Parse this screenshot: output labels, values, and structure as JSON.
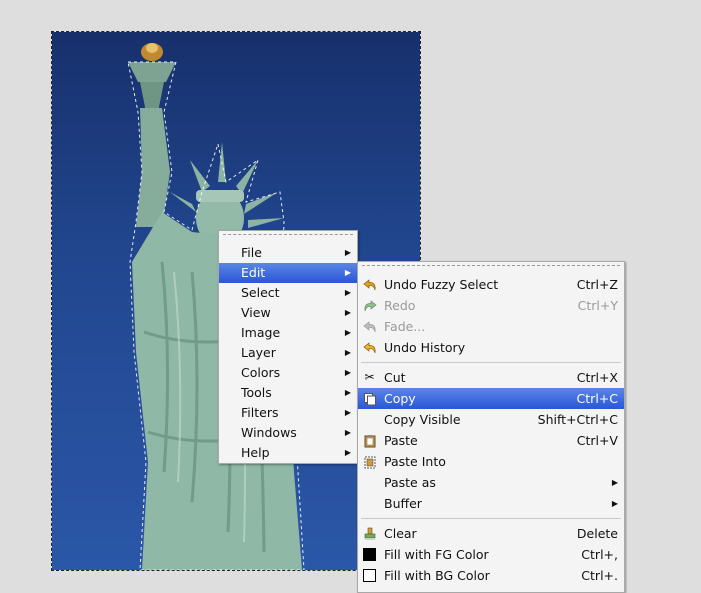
{
  "main_menu": {
    "items": [
      {
        "label": "File"
      },
      {
        "label": "Edit"
      },
      {
        "label": "Select"
      },
      {
        "label": "View"
      },
      {
        "label": "Image"
      },
      {
        "label": "Layer"
      },
      {
        "label": "Colors"
      },
      {
        "label": "Tools"
      },
      {
        "label": "Filters"
      },
      {
        "label": "Windows"
      },
      {
        "label": "Help"
      }
    ],
    "selected": "Edit"
  },
  "edit_menu": {
    "undo": {
      "label": "Undo Fuzzy Select",
      "shortcut": "Ctrl+Z",
      "icon": "undo-icon"
    },
    "redo": {
      "label": "Redo",
      "shortcut": "Ctrl+Y",
      "icon": "redo-icon"
    },
    "fade": {
      "label": "Fade...",
      "icon": "fade-icon"
    },
    "undo_history": {
      "label": "Undo History",
      "icon": "undo-history-icon"
    },
    "cut": {
      "label": "Cut",
      "shortcut": "Ctrl+X",
      "icon": "scissors-icon"
    },
    "copy": {
      "label": "Copy",
      "shortcut": "Ctrl+C",
      "icon": "copy-icon"
    },
    "copy_visible": {
      "label": "Copy Visible",
      "shortcut": "Shift+Ctrl+C"
    },
    "paste": {
      "label": "Paste",
      "shortcut": "Ctrl+V",
      "icon": "paste-icon"
    },
    "paste_into": {
      "label": "Paste Into",
      "icon": "paste-into-icon"
    },
    "paste_as": {
      "label": "Paste as"
    },
    "buffer": {
      "label": "Buffer"
    },
    "clear": {
      "label": "Clear",
      "shortcut": "Delete",
      "icon": "clear-icon"
    },
    "fill_fg": {
      "label": "Fill with FG Color",
      "shortcut": "Ctrl+,",
      "color": "#000000"
    },
    "fill_bg": {
      "label": "Fill with BG Color",
      "shortcut": "Ctrl+.",
      "color": "#ffffff"
    }
  },
  "colors": {
    "menu_bg": "#f4f4f4",
    "highlight": "#2a56d8",
    "sky": "#21468e",
    "statue": "#8fb8a6"
  }
}
